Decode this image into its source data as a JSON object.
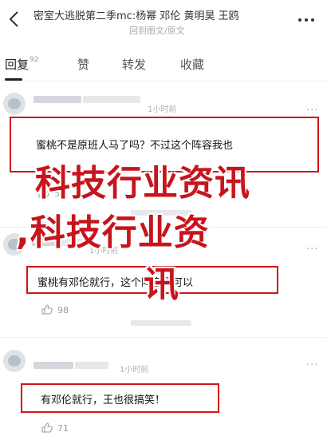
{
  "header": {
    "title": "密室大逃脱第二季mc:杨幂 邓伦 黄明昊 王鸥",
    "subtitle": "回到图文/原文",
    "back_icon": "chevron-left-icon",
    "more_icon": "ellipsis-icon"
  },
  "tabs": [
    {
      "label": "回复",
      "count": "92"
    },
    {
      "label": "赞"
    },
    {
      "label": "转发"
    },
    {
      "label": "收藏"
    }
  ],
  "comments": [
    {
      "time": "1小时前",
      "text": "蜜桃不是原班人马了吗？不过这个阵容我也",
      "likes": "56"
    },
    {
      "time": "1小时前",
      "text": "蜜桃有邓伦就行，这个阵容我可以",
      "likes": "98"
    },
    {
      "time": "1小时前",
      "text": "有邓伦就行，王也很搞笑！",
      "likes": "71"
    }
  ],
  "watermark": {
    "line1": "科技行业资讯",
    "line2": ",科技行业资",
    "line3": "讯"
  },
  "colors": {
    "highlight_border": "#d0141c",
    "watermark": "#c8141c"
  }
}
